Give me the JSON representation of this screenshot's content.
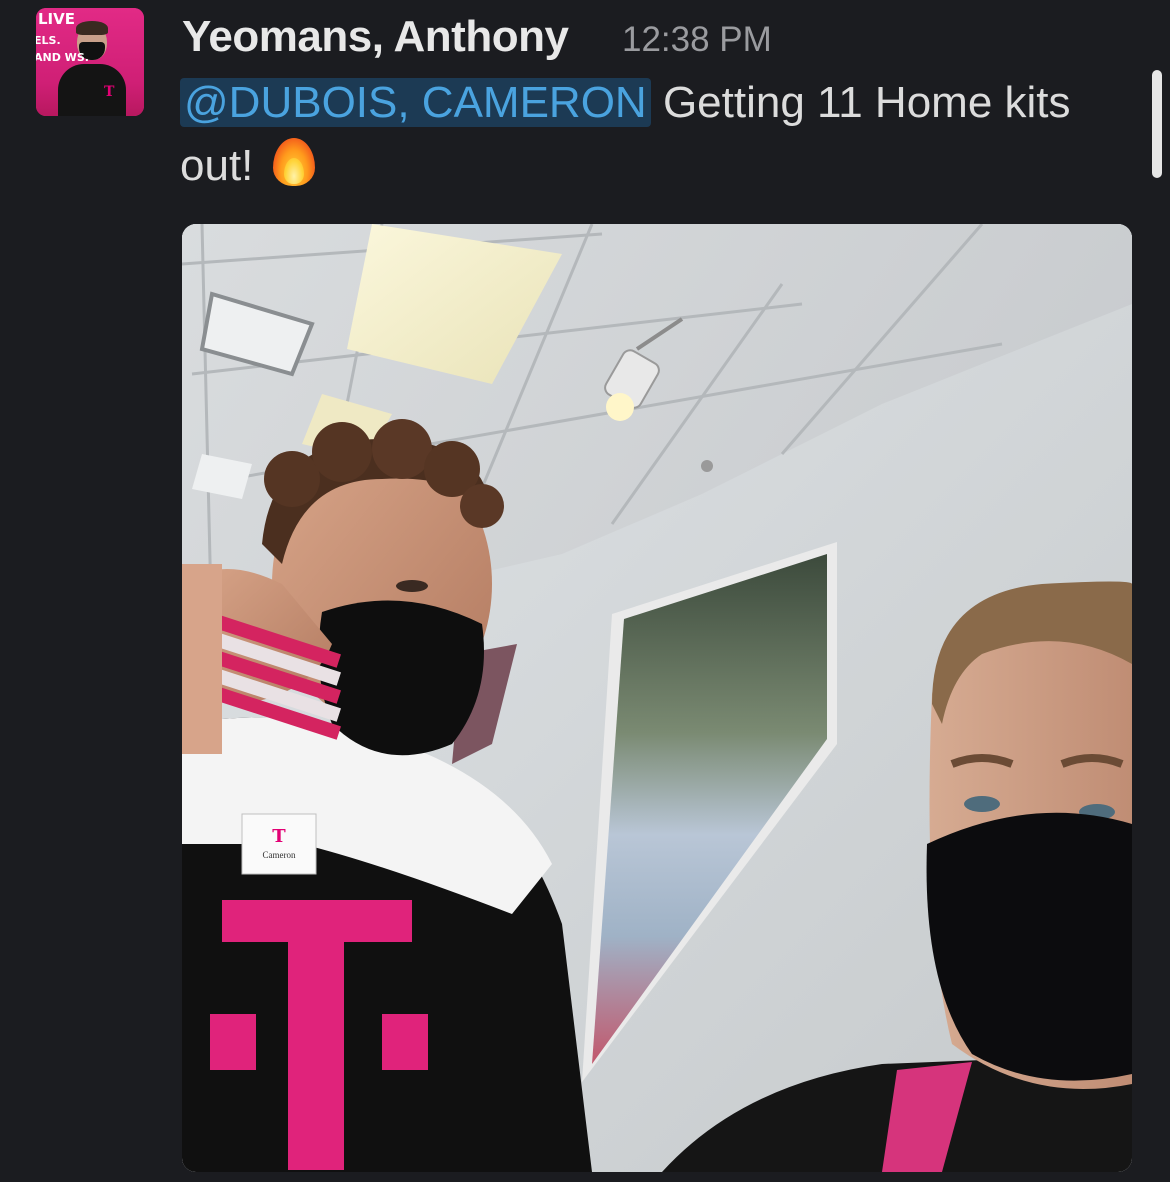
{
  "message": {
    "author": "Yeomans, Anthony",
    "timestamp": "12:38 PM",
    "mention": "@DUBOIS, CAMERON",
    "text": " Getting 11 Home kits out!",
    "emoji": "fire-emoji"
  },
  "avatar": {
    "sign_line1": "LIVE",
    "sign_line2": "ELS.",
    "sign_line3": "AND WS."
  },
  "photo": {
    "name_tag_text": "Cameron",
    "brand_letter": "T"
  },
  "colors": {
    "background": "#1b1c20",
    "mention_text": "#4aa3df",
    "mention_bg": "#1c3a54",
    "brand_magenta": "#e20074"
  }
}
